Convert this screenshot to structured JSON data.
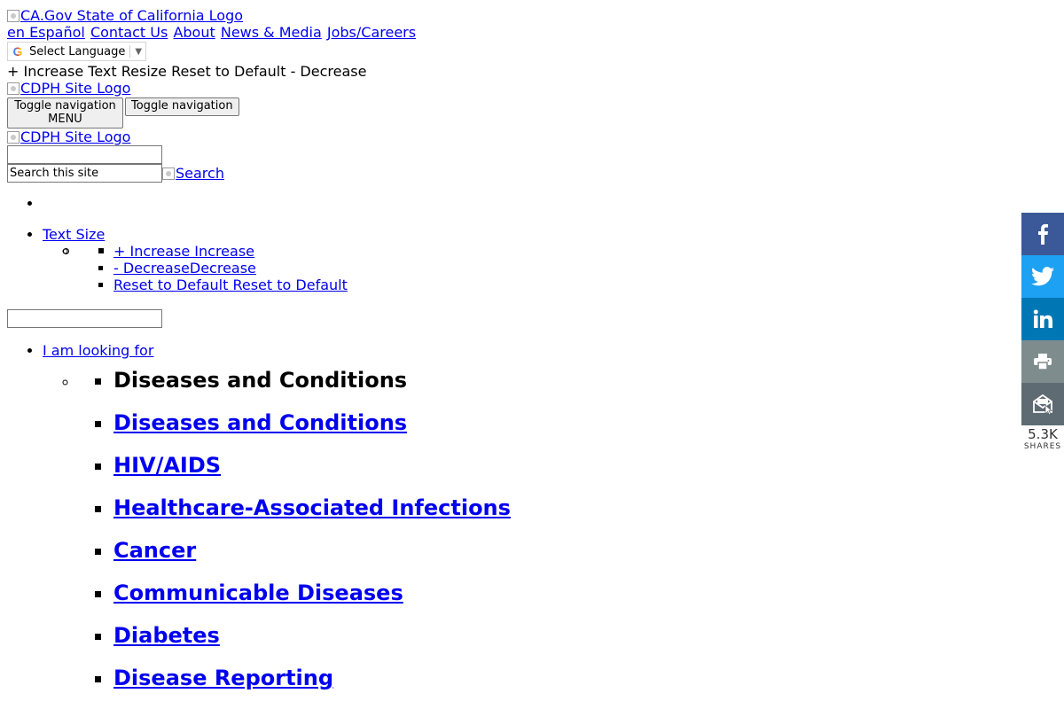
{
  "header": {
    "ca_logo_alt": "CA.Gov State of California Logo",
    "util_links": [
      "en Español",
      "Contact Us",
      "About",
      "News & Media",
      "Jobs/Careers"
    ],
    "translate": {
      "label": "Select Language",
      "arrow": "▼"
    },
    "text_resize_line": "+ Increase Text Resize Reset to Default - Decrease",
    "cdph_logo_alt": "CDPH Site Logo",
    "toggle_nav_menu_line1": "Toggle navigation",
    "toggle_nav_menu_line2": "MENU",
    "toggle_nav": "Toggle navigation",
    "cdph_logo_alt_2": "CDPH Site Logo",
    "search_value": "Search this site",
    "search_button_alt": "Search"
  },
  "text_size_menu": {
    "label": "Text Size",
    "items": [
      "+ Increase Increase",
      "- DecreaseDecrease",
      "Reset to Default Reset to Default"
    ]
  },
  "looking_for": {
    "label": "I am looking for",
    "heading": "Diseases and Conditions",
    "links": [
      "Diseases and Conditions",
      "HIV/AIDS",
      "Healthcare-Associated Infections",
      "Cancer",
      "Communicable Diseases",
      "Diabetes",
      "Disease Reporting"
    ]
  },
  "share_bar": {
    "count": "5.3K",
    "label": "SHARES",
    "colors": {
      "facebook": "#3b5998",
      "twitter": "#1da1f2",
      "linkedin": "#0077b5",
      "print": "#7f8c8d",
      "email": "#5f6b73"
    },
    "icons": [
      "facebook-icon",
      "twitter-icon",
      "linkedin-icon",
      "print-icon",
      "email-icon"
    ]
  }
}
